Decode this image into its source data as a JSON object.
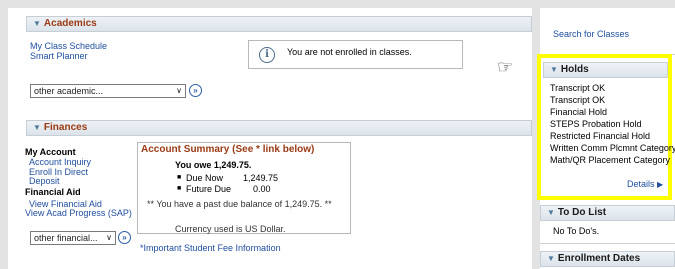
{
  "academics": {
    "header": "Academics",
    "links": [
      "My Class Schedule",
      "Smart Planner"
    ],
    "notice": "You are not enrolled in classes.",
    "select_value": "other academic..."
  },
  "finances": {
    "header": "Finances",
    "my_account_label": "My Account",
    "account_links": [
      "Account Inquiry",
      "Enroll In Direct",
      "Deposit"
    ],
    "financial_aid_label": "Financial Aid",
    "aid_links": [
      "View Financial Aid",
      "View Acad Progress (SAP)"
    ],
    "select_value": "other financial...",
    "summary": {
      "title": "Account Summary (See * link below)",
      "owe": "You owe 1,249.75.",
      "due_now_label": "Due Now",
      "due_now_value": "1,249.75",
      "future_due_label": "Future Due",
      "future_due_value": "0.00",
      "past_due": "** You have a past due balance of 1,249.75. **",
      "currency": "Currency used is US Dollar."
    },
    "fee_link": "*Important Student Fee Information"
  },
  "right": {
    "search_link": "Search for Classes",
    "holds_header": "Holds",
    "holds": [
      "Transcript OK",
      "Transcript OK",
      "Financial Hold",
      "STEPS Probation Hold",
      "Restricted Financial Hold",
      "Written Comm Plcmnt Category",
      "Math/QR Placement Category"
    ],
    "details_link": "Details",
    "todo_header": "To Do List",
    "todo_text": "No To Do's.",
    "enroll_header": "Enrollment Dates"
  },
  "icons": {
    "triangle": "triangle-down-icon",
    "info": "info-icon",
    "go": "go-arrow-icon",
    "hand": "pointing-hand-icon",
    "details_arrow": "arrow-right-icon"
  }
}
